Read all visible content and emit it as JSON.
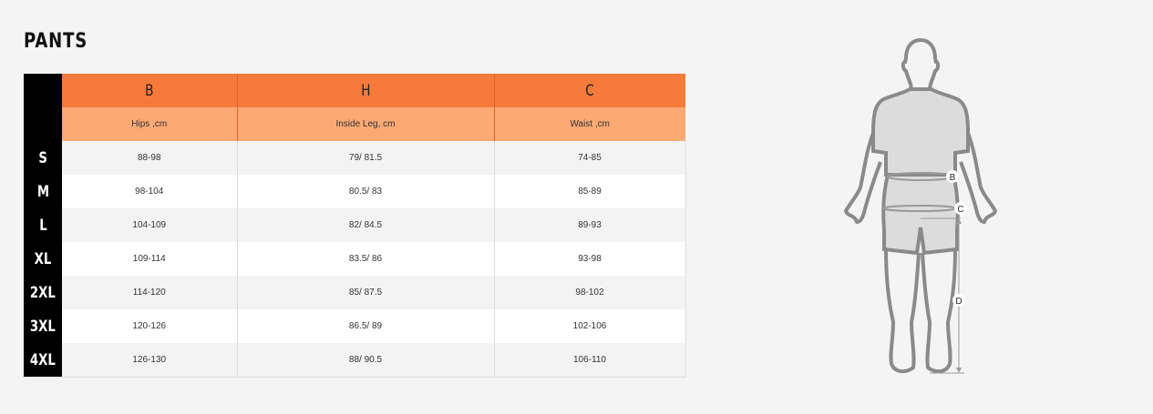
{
  "title": "PANTS",
  "columns": [
    {
      "letter": "B",
      "description": "Hips ,cm"
    },
    {
      "letter": "H",
      "description": "Inside Leg, cm"
    },
    {
      "letter": "C",
      "description": "Waist ,cm"
    }
  ],
  "rows": [
    {
      "size": "S",
      "values": [
        "88-98",
        "79/ 81.5",
        "74-85"
      ]
    },
    {
      "size": "M",
      "values": [
        "98-104",
        "80.5/ 83",
        "85-89"
      ]
    },
    {
      "size": "L",
      "values": [
        "104-109",
        "82/ 84.5",
        "89-93"
      ]
    },
    {
      "size": "XL",
      "values": [
        "109-114",
        "83.5/ 86",
        "93-98"
      ]
    },
    {
      "size": "2XL",
      "values": [
        "114-120",
        "85/ 87.5",
        "98-102"
      ]
    },
    {
      "size": "3XL",
      "values": [
        "120-126",
        "86.5/ 89",
        "102-106"
      ]
    },
    {
      "size": "4XL",
      "values": [
        "126-130",
        "88/ 90.5",
        "106-110"
      ]
    }
  ],
  "figure": {
    "markers": {
      "hips": "B",
      "waist": "C",
      "inseam": "D"
    }
  },
  "colors": {
    "header_dark": "#f57a3c",
    "header_light": "#fca974",
    "size_column": "#000000",
    "figure_outline": "#8a8a8a",
    "figure_fill": "#d9d9d9"
  }
}
